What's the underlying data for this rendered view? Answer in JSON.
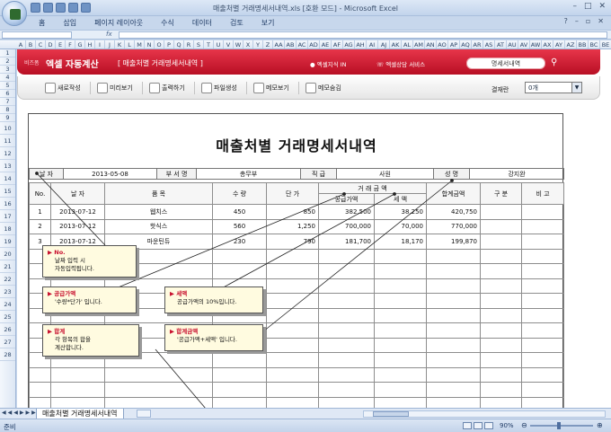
{
  "window": {
    "title": "매출처별 거래명세서내역.xls  [호환 모드] - Microsoft Excel"
  },
  "ribbon": {
    "tabs": [
      "홈",
      "삽입",
      "페이지 레이아웃",
      "수식",
      "데이터",
      "검토",
      "보기"
    ]
  },
  "formula_bar": {
    "fx": "fx"
  },
  "columns": [
    "A",
    "B",
    "C",
    "D",
    "E",
    "F",
    "G",
    "H",
    "I",
    "J",
    "K",
    "L",
    "M",
    "N",
    "O",
    "P",
    "Q",
    "R",
    "S",
    "T",
    "U",
    "V",
    "W",
    "X",
    "Y",
    "Z",
    "AA",
    "AB",
    "AC",
    "AD",
    "AE",
    "AF",
    "AG",
    "AH",
    "AI",
    "AJ",
    "AK",
    "AL",
    "AM",
    "AN",
    "AO",
    "AP",
    "AQ",
    "AR",
    "AS",
    "AT",
    "AU",
    "AV",
    "AW",
    "AX",
    "AY",
    "AZ",
    "BB",
    "BC",
    "BE"
  ],
  "rows": [
    "1",
    "2",
    "3",
    "4",
    "5",
    "6",
    "7",
    "8",
    "9",
    "10",
    "11",
    "12",
    "13",
    "14",
    "15",
    "16",
    "17",
    "18",
    "19",
    "20",
    "21",
    "22",
    "23",
    "24",
    "25",
    "26",
    "27",
    "28"
  ],
  "banner": {
    "brand_small": "비즈폼",
    "brand": "엑셀 자동계산",
    "subtitle": "[ 매출처별 거래명세서내역 ]",
    "nav1": "엑셀지식 IN",
    "nav2": "엑셀상담 서비스",
    "search_value": "명세서내역"
  },
  "toolbar": {
    "new": "새로작성",
    "preview": "미리보기",
    "print": "출력하기",
    "file": "파일생성",
    "memo_show": "메모보기",
    "memo_hide": "메모숨김",
    "rate_label": "결재란",
    "rate_value": "0개"
  },
  "doc": {
    "title": "매출처별 거래명세서내역",
    "info": {
      "date_label": "날 자",
      "date": "2013-05-08",
      "dept_label": "부 서 명",
      "dept": "총무부",
      "pos_label": "직 급",
      "pos": "사원",
      "name_label": "성 명",
      "name": "강지완"
    },
    "headers": {
      "no": "No.",
      "date": "날 자",
      "item": "품 목",
      "qty": "수 량",
      "price": "단 가",
      "amount_group": "거 래 금 액",
      "supply": "공급가액",
      "tax": "세 액",
      "total": "합계금액",
      "type": "구 분",
      "note": "비 고"
    },
    "rows": [
      {
        "no": "1",
        "date": "2013-07-12",
        "item": "웹치스",
        "qty": "450",
        "price": "850",
        "supply": "382,500",
        "tax": "38,250",
        "total": "420,750"
      },
      {
        "no": "2",
        "date": "2013-07-12",
        "item": "핫식스",
        "qty": "560",
        "price": "1,250",
        "supply": "700,000",
        "tax": "70,000",
        "total": "770,000"
      },
      {
        "no": "3",
        "date": "2013-07-12",
        "item": "마운틴듀",
        "qty": "230",
        "price": "790",
        "supply": "181,700",
        "tax": "18,170",
        "total": "199,870"
      }
    ]
  },
  "callouts": {
    "no": {
      "title": "▶ No.",
      "body1": "날짜 입력 시",
      "body2": "자동입력됩니다."
    },
    "supply": {
      "title": "▶ 공급가액",
      "body1": "'수량*단가' 입니다."
    },
    "tax": {
      "title": "▶ 세액",
      "body1": "공급가액의 10%입니다."
    },
    "sum": {
      "title": "▶ 합계",
      "body1": "각 항목의 합을",
      "body2": "계산합니다."
    },
    "total": {
      "title": "▶ 합계금액",
      "body1": "'공급가액+세액' 입니다."
    }
  },
  "sheet_tab": "매출처별 거래명세서내역",
  "status": {
    "ready": "준비",
    "zoom": "90%"
  }
}
